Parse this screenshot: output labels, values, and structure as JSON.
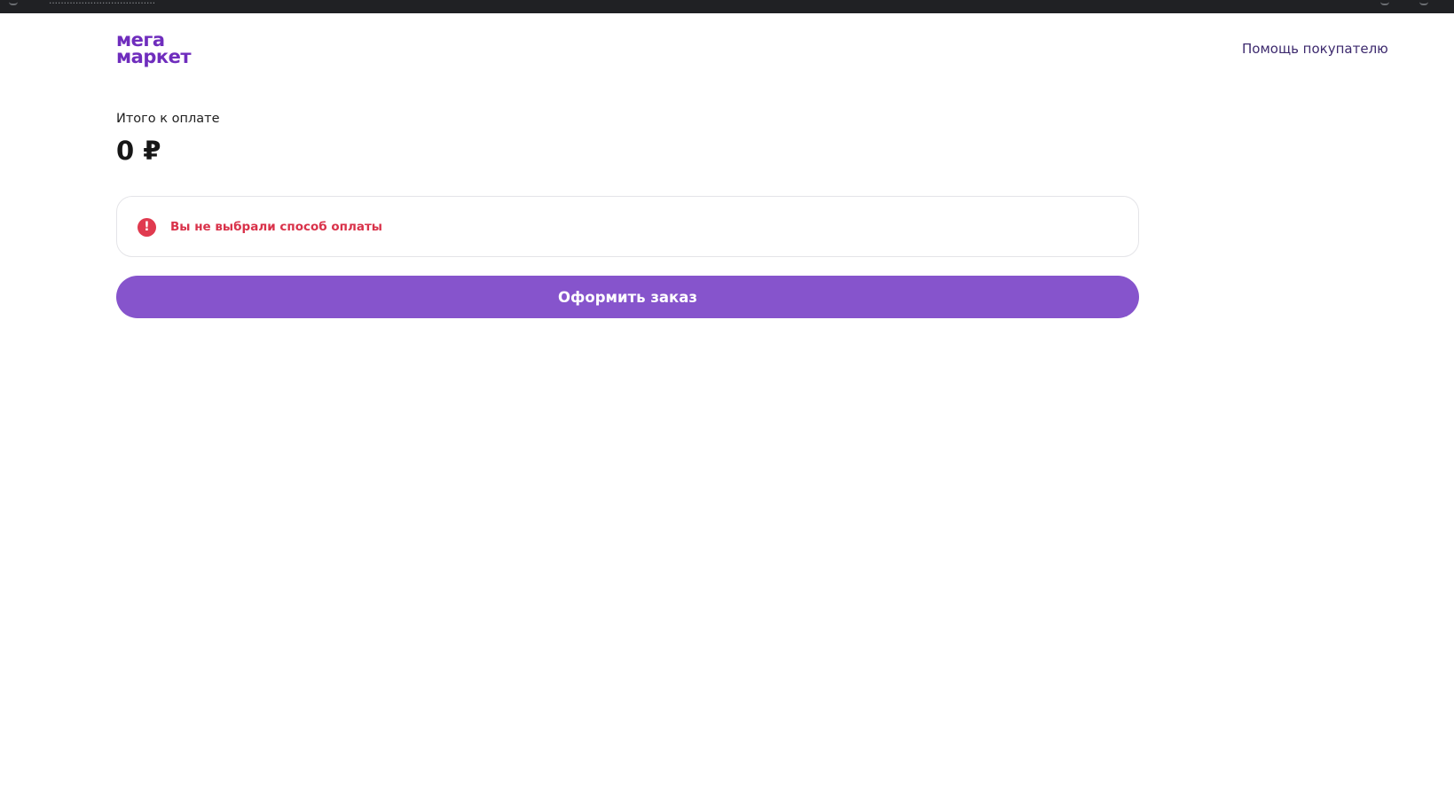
{
  "browser": {
    "address_text": "...................................."
  },
  "header": {
    "logo_line1": "мега",
    "logo_line2": "маркет",
    "help_link": "Помощь покупателю"
  },
  "summary": {
    "total_label": "Итого к оплате",
    "total_amount": "0 ₽"
  },
  "alert": {
    "icon": "exclamation-icon",
    "icon_glyph": "!",
    "message": "Вы не выбрали способ оплаты"
  },
  "actions": {
    "submit_label": "Оформить заказ"
  },
  "colors": {
    "brand": "#6f2dbd",
    "button": "#8654cc",
    "error": "#d9324a",
    "browser_chrome": "#202124"
  }
}
